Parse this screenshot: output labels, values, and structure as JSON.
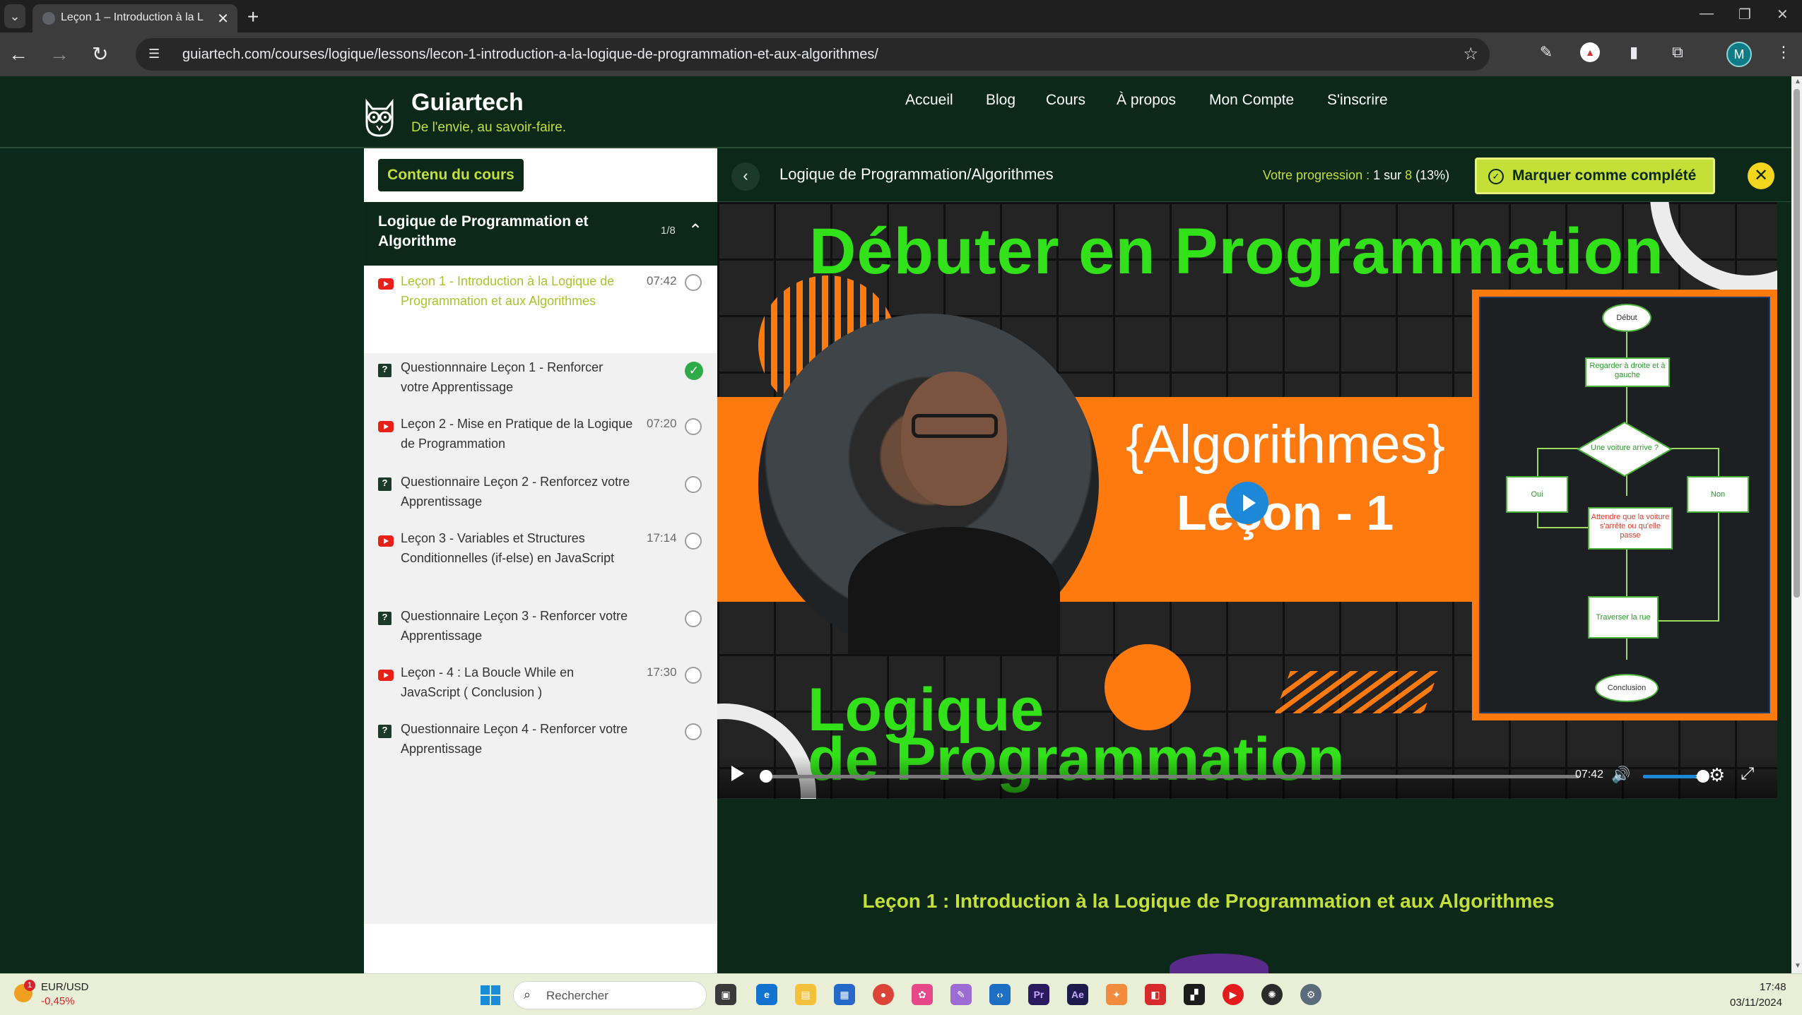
{
  "browser": {
    "tab_title": "Leçon 1 – Introduction à la L",
    "url": "guiartech.com/courses/logique/lessons/lecon-1-introduction-a-la-logique-de-programmation-et-aux-algorithmes/",
    "profile_initial": "M"
  },
  "site": {
    "name": "Guiartech",
    "tagline": "De l'envie, au savoir-faire.",
    "nav": [
      "Accueil",
      "Blog",
      "Cours",
      "À propos",
      "Mon Compte",
      "S'inscrire"
    ],
    "accent_color": "#c4df38",
    "bg_color": "#0b2818"
  },
  "sidebar": {
    "content_button": "Contenu du cours",
    "section_title": "Logique de Programmation et Algorithme",
    "section_count": "1/8",
    "lessons": [
      {
        "type": "video",
        "title": "Leçon 1 - Introduction à la Logique de Programmation et aux Algorithmes",
        "duration": "07:42",
        "status": "current"
      },
      {
        "type": "quiz",
        "title": "Questionnnaire Leçon 1 - Renforcer votre Apprentissage",
        "duration": "",
        "status": "completed"
      },
      {
        "type": "video",
        "title": "Leçon 2 - Mise en Pratique de la Logique de Programmation",
        "duration": "07:20",
        "status": "pending"
      },
      {
        "type": "quiz",
        "title": "Questionnaire Leçon 2 - Renforcez votre Apprentissage",
        "duration": "",
        "status": "pending"
      },
      {
        "type": "video",
        "title": "Leçon 3 - Variables et Structures Conditionnelles (if-else) en JavaScript",
        "duration": "17:14",
        "status": "pending"
      },
      {
        "type": "quiz",
        "title": "Questionnaire Leçon 3 - Renforcer votre Apprentissage",
        "duration": "",
        "status": "pending"
      },
      {
        "type": "video",
        "title": "Leçon - 4 : La Boucle While en JavaScript ( Conclusion )",
        "duration": "17:30",
        "status": "pending"
      },
      {
        "type": "quiz",
        "title": "Questionnaire Leçon 4 - Renforcer votre Apprentissage",
        "duration": "",
        "status": "pending"
      }
    ]
  },
  "content": {
    "course_title": "Logique de Programmation/Algorithmes",
    "progress_prefix": "Votre progression : ",
    "progress_done": "1",
    "progress_sep": " sur ",
    "progress_total": "8",
    "progress_pct": " (13%)",
    "complete_button": "Marquer comme complété",
    "lesson_heading": "Leçon 1 : Introduction à la Logique de Programmation et aux Algorithmes"
  },
  "video": {
    "title_top": "Débuter en Programmation",
    "algo": "{Algorithmes}",
    "lecon": "Leçon - 1",
    "bottom_line1": "Logique",
    "bottom_line2": "de Programmation",
    "time": "07:42",
    "played_fraction": 0.0,
    "volume_fraction": 0.9,
    "flowchart": {
      "start": "Début",
      "step1": "Regarder à droite et à gauche",
      "decision": "Une voiture arrive ?",
      "yes": "Oui",
      "no": "Non",
      "wait": "Attendre que la voiture s'arrête ou qu'elle passe",
      "cross": "Traverser la rue",
      "end": "Conclusion"
    }
  },
  "taskbar": {
    "ticker_name": "EUR/USD",
    "ticker_change": "-0,45%",
    "ticker_badge": "1",
    "search_placeholder": "Rechercher",
    "time": "17:48",
    "date": "03/11/2024"
  }
}
